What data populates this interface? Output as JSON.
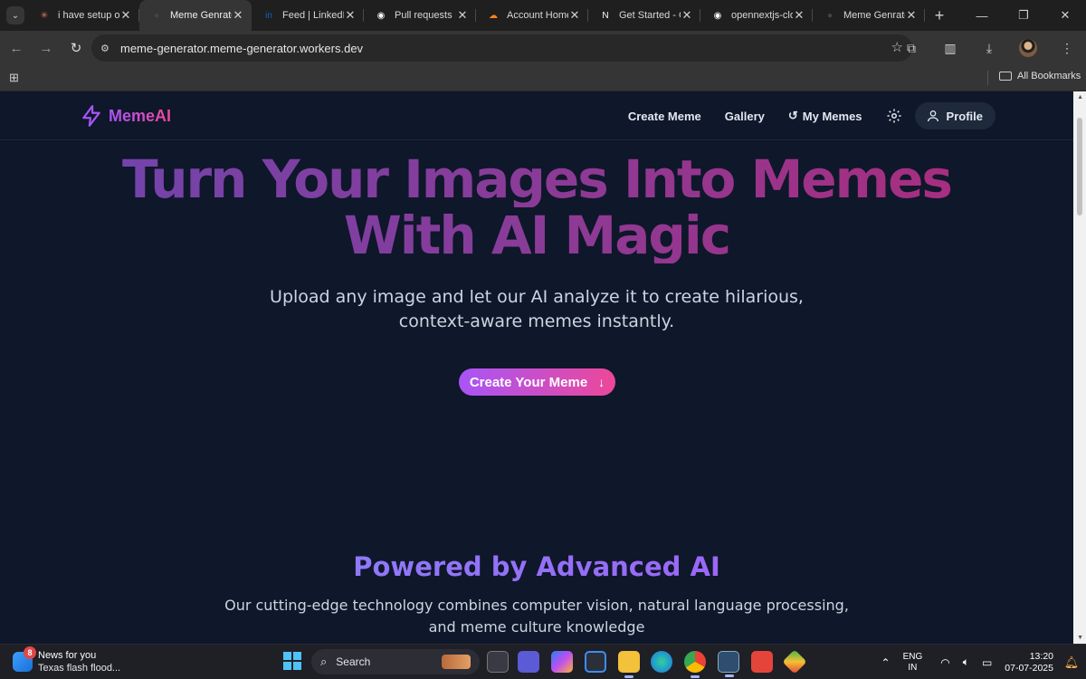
{
  "browser": {
    "tabs": [
      {
        "title": "i have setup on",
        "favicon": "claude-icon",
        "color": "#d97757",
        "glyph": "✳",
        "active": false
      },
      {
        "title": "Meme Genrator",
        "favicon": "meme-favicon-icon",
        "color": "#444444",
        "glyph": "●",
        "active": true
      },
      {
        "title": "Feed | LinkedIn",
        "favicon": "linkedin-icon",
        "color": "#0a66c2",
        "glyph": "in",
        "active": false
      },
      {
        "title": "Pull requests ·",
        "favicon": "github-icon",
        "color": "#ffffff",
        "glyph": "◉",
        "active": false
      },
      {
        "title": "Account Home",
        "favicon": "cloudflare-icon",
        "color": "#f6821f",
        "glyph": "☁",
        "active": false
      },
      {
        "title": "Get Started - C",
        "favicon": "notion-icon",
        "color": "#ffffff",
        "glyph": "N",
        "active": false
      },
      {
        "title": "opennextjs-clo",
        "favicon": "github-icon",
        "color": "#ffffff",
        "glyph": "◉",
        "active": false
      },
      {
        "title": "Meme Genrator",
        "favicon": "meme-favicon-icon",
        "color": "#444444",
        "glyph": "●",
        "active": false
      }
    ],
    "url": "meme-generator.meme-generator.workers.dev",
    "bookmarks_label": "All Bookmarks"
  },
  "site": {
    "logo_text": "MemeAI",
    "nav": {
      "create": "Create Meme",
      "gallery": "Gallery",
      "my_memes": "My Memes",
      "profile": "Profile"
    },
    "hero": {
      "title_line1": "Turn Your Images Into Memes",
      "title_line2": "With AI Magic",
      "subtitle": "Upload any image and let our AI analyze it to create hilarious, context-aware memes instantly.",
      "cta": "Create Your Meme"
    },
    "section": {
      "title": "Powered by Advanced AI",
      "subtitle": "Our cutting-edge technology combines computer vision, natural language processing, and meme culture knowledge"
    },
    "colors": {
      "background": "#0f172a",
      "accent_start": "#a855f7",
      "accent_end": "#ec4899"
    }
  },
  "taskbar": {
    "news_badge": "8",
    "news_title": "News for you",
    "news_sub": "Texas flash flood...",
    "search_label": "Search",
    "lang_top": "ENG",
    "lang_bottom": "IN",
    "time": "13:20",
    "date": "07-07-2025"
  }
}
